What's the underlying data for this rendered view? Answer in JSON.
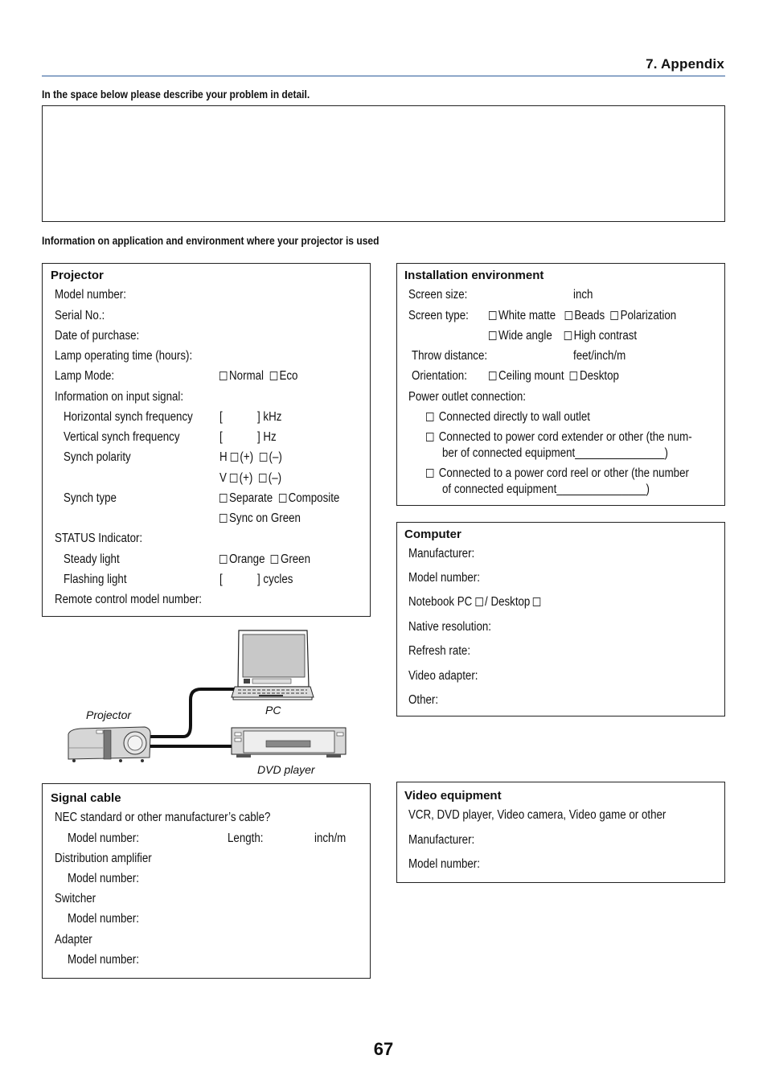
{
  "header": {
    "chapter": "7. Appendix",
    "page_number": "67"
  },
  "problem_section": {
    "heading": "In the space below please describe your problem in detail.",
    "description_value": ""
  },
  "info_section": {
    "heading": "Information on application and environment where your projector is used"
  },
  "projector": {
    "title": "Projector",
    "model_number": "Model number:",
    "serial_no": "Serial No.:",
    "date_of_purchase": "Date of purchase:",
    "lamp_time": "Lamp operating time (hours):",
    "lamp_mode": {
      "label": "Lamp Mode:",
      "options": [
        "Normal",
        "Eco"
      ]
    },
    "input_signal": "Information on input signal:",
    "h_freq": {
      "label": "Horizontal synch frequency",
      "open": "[",
      "close": "] kHz"
    },
    "v_freq": {
      "label": "Vertical synch frequency",
      "open": "[",
      "close": "] Hz"
    },
    "synch_polarity": {
      "label": "Synch polarity",
      "h": "H",
      "v": "V",
      "plus": "(+)",
      "minus": "(–)"
    },
    "synch_type": {
      "label": "Synch type",
      "options": [
        "Separate",
        "Composite",
        "Sync on Green"
      ]
    },
    "status_indicator": "STATUS Indicator:",
    "steady_light": {
      "label": "Steady light",
      "options": [
        "Orange",
        "Green"
      ]
    },
    "flashing_light": {
      "label": "Flashing light",
      "open": "[",
      "close": "] cycles"
    },
    "remote_model": "Remote control model number:"
  },
  "installation": {
    "title": "Installation environment",
    "screen_size": {
      "label": "Screen size:",
      "unit": "inch"
    },
    "screen_type": {
      "label": "Screen type:",
      "options": [
        "White matte",
        "Beads",
        "Polarization",
        "Wide angle",
        "High contrast"
      ]
    },
    "throw_distance": {
      "label": "Throw distance:",
      "unit": "feet/inch/m"
    },
    "orientation": {
      "label": "Orientation:",
      "options": [
        "Ceiling mount",
        "Desktop"
      ]
    },
    "power_outlet": {
      "label": "Power outlet connection:",
      "options": [
        [
          "Connected directly to wall outlet"
        ],
        [
          "Connected to power cord extender or other (the num-",
          "ber of connected equipment_______________)"
        ],
        [
          "Connected to a power cord reel or other (the number",
          "of connected equipment_______________)"
        ]
      ]
    }
  },
  "computer": {
    "title": "Computer",
    "manufacturer": "Manufacturer:",
    "model_number": "Model number:",
    "type": {
      "notebook": "Notebook PC",
      "sep": "/ Desktop"
    },
    "native_resolution": "Native resolution:",
    "refresh_rate": "Refresh rate:",
    "video_adapter": "Video adapter:",
    "other": "Other:"
  },
  "diagram": {
    "projector": "Projector",
    "pc": "PC",
    "dvd": "DVD player"
  },
  "signal_cable": {
    "title": "Signal cable",
    "nec_question": "NEC standard or other manufacturer’s cable?",
    "model_number": "Model number:",
    "length": "Length:",
    "length_unit": "inch/m",
    "distribution_amplifier": "Distribution amplifier",
    "switcher": "Switcher",
    "adapter": "Adapter"
  },
  "video_equipment": {
    "title": "Video equipment",
    "types": "VCR, DVD player, Video camera, Video game or other",
    "manufacturer": "Manufacturer:",
    "model_number": "Model number:"
  }
}
